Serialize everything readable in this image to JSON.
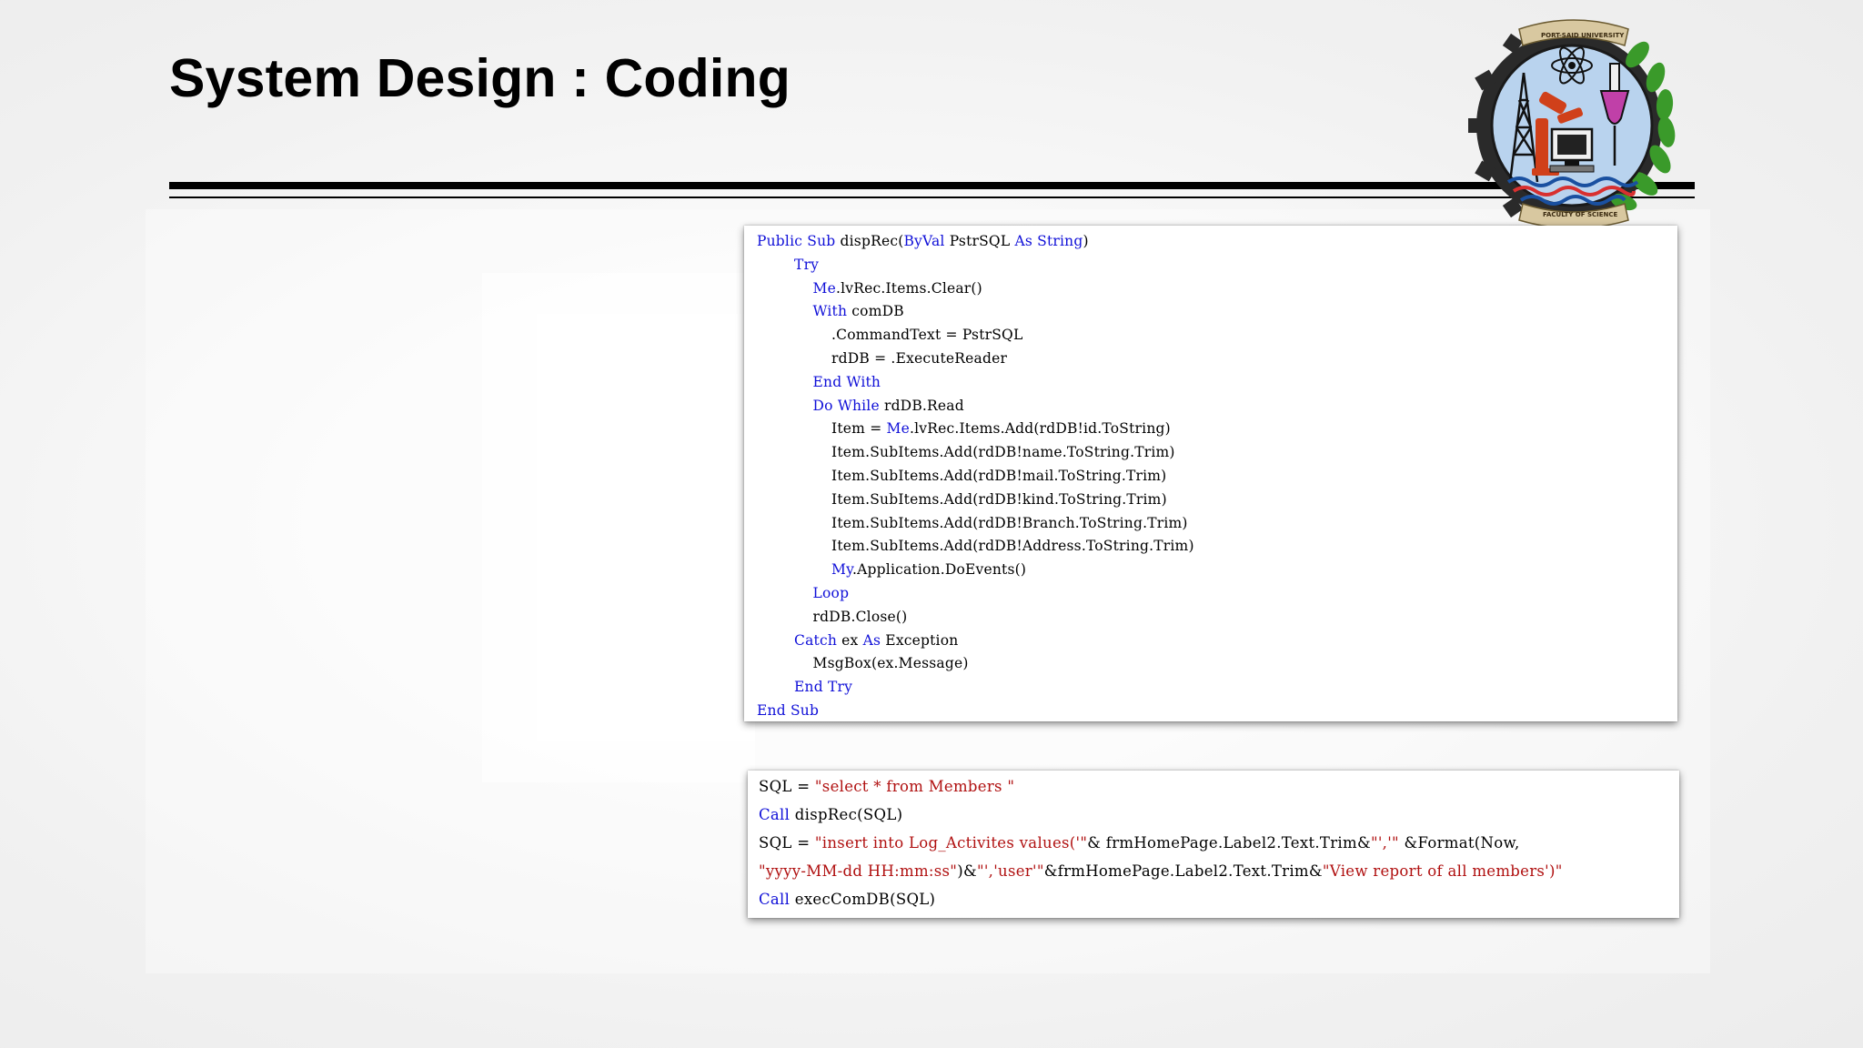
{
  "slide": {
    "title": "System Design : Coding"
  },
  "logo": {
    "top_text": "PORT-SAID UNIVERSITY",
    "bottom_text": "FACULTY OF SCIENCE"
  },
  "colors": {
    "keyword": "#1010d8",
    "string": "#b01010",
    "plain": "#000000",
    "title": "#000000"
  },
  "code_main": {
    "lines": [
      {
        "indent": "",
        "tokens": [
          {
            "t": "keyword",
            "v": "Public Sub"
          },
          {
            "t": "plain",
            "v": " dispRec("
          },
          {
            "t": "keyword",
            "v": "ByVal"
          },
          {
            "t": "plain",
            "v": " PstrSQL "
          },
          {
            "t": "keyword",
            "v": "As String"
          },
          {
            "t": "plain",
            "v": ")"
          }
        ]
      },
      {
        "indent": "        ",
        "tokens": [
          {
            "t": "keyword",
            "v": "Try"
          }
        ]
      },
      {
        "indent": "            ",
        "tokens": [
          {
            "t": "keyword",
            "v": "Me"
          },
          {
            "t": "plain",
            "v": ".lvRec.Items.Clear()"
          }
        ]
      },
      {
        "indent": "            ",
        "tokens": [
          {
            "t": "keyword",
            "v": "With"
          },
          {
            "t": "plain",
            "v": " comDB"
          }
        ]
      },
      {
        "indent": "                ",
        "tokens": [
          {
            "t": "plain",
            "v": ".CommandText = PstrSQL"
          }
        ]
      },
      {
        "indent": "                ",
        "tokens": [
          {
            "t": "plain",
            "v": "rdDB = .ExecuteReader"
          }
        ]
      },
      {
        "indent": "            ",
        "tokens": [
          {
            "t": "keyword",
            "v": "End With"
          }
        ]
      },
      {
        "indent": "            ",
        "tokens": [
          {
            "t": "keyword",
            "v": "Do While"
          },
          {
            "t": "plain",
            "v": " rdDB.Read"
          }
        ]
      },
      {
        "indent": "                ",
        "tokens": [
          {
            "t": "plain",
            "v": "Item = "
          },
          {
            "t": "keyword",
            "v": "Me"
          },
          {
            "t": "plain",
            "v": ".lvRec.Items.Add(rdDB!id.ToString)"
          }
        ]
      },
      {
        "indent": "                ",
        "tokens": [
          {
            "t": "plain",
            "v": "Item.SubItems.Add(rdDB!name.ToString.Trim)"
          }
        ]
      },
      {
        "indent": "                ",
        "tokens": [
          {
            "t": "plain",
            "v": "Item.SubItems.Add(rdDB!mail.ToString.Trim)"
          }
        ]
      },
      {
        "indent": "                ",
        "tokens": [
          {
            "t": "plain",
            "v": "Item.SubItems.Add(rdDB!kind.ToString.Trim)"
          }
        ]
      },
      {
        "indent": "                ",
        "tokens": [
          {
            "t": "plain",
            "v": "Item.SubItems.Add(rdDB!Branch.ToString.Trim)"
          }
        ]
      },
      {
        "indent": "                ",
        "tokens": [
          {
            "t": "plain",
            "v": "Item.SubItems.Add(rdDB!Address.ToString.Trim)"
          }
        ]
      },
      {
        "indent": "                ",
        "tokens": [
          {
            "t": "keyword",
            "v": "My"
          },
          {
            "t": "plain",
            "v": ".Application.DoEvents()"
          }
        ]
      },
      {
        "indent": "            ",
        "tokens": [
          {
            "t": "keyword",
            "v": "Loop"
          }
        ]
      },
      {
        "indent": "            ",
        "tokens": [
          {
            "t": "plain",
            "v": "rdDB.Close()"
          }
        ]
      },
      {
        "indent": "        ",
        "tokens": [
          {
            "t": "keyword",
            "v": "Catch"
          },
          {
            "t": "plain",
            "v": " ex "
          },
          {
            "t": "keyword",
            "v": "As"
          },
          {
            "t": "plain",
            "v": " Exception"
          }
        ]
      },
      {
        "indent": "            ",
        "tokens": [
          {
            "t": "plain",
            "v": "MsgBox(ex.Message)"
          }
        ]
      },
      {
        "indent": "        ",
        "tokens": [
          {
            "t": "keyword",
            "v": "End Try"
          }
        ]
      },
      {
        "indent": "",
        "tokens": [
          {
            "t": "keyword",
            "v": "End Sub"
          }
        ]
      }
    ]
  },
  "code_sql": {
    "lines": [
      {
        "indent": "",
        "tokens": [
          {
            "t": "plain",
            "v": "SQL = "
          },
          {
            "t": "string",
            "v": "\"select * from Members \""
          }
        ]
      },
      {
        "indent": "",
        "tokens": [
          {
            "t": "keyword",
            "v": "Call"
          },
          {
            "t": "plain",
            "v": " dispRec(SQL)"
          }
        ]
      },
      {
        "indent": "",
        "tokens": [
          {
            "t": "plain",
            "v": "SQL = "
          },
          {
            "t": "string",
            "v": "\"insert into Log_Activites values('\""
          },
          {
            "t": "plain",
            "v": "& frmHomePage.Label2.Text.Trim&"
          },
          {
            "t": "string",
            "v": "\"','\""
          },
          {
            "t": "plain",
            "v": " &Format(Now,"
          }
        ]
      },
      {
        "indent": "",
        "tokens": [
          {
            "t": "string",
            "v": "\"yyyy-MM-dd HH:mm:ss\""
          },
          {
            "t": "plain",
            "v": ")&"
          },
          {
            "t": "string",
            "v": "\"','user'\""
          },
          {
            "t": "plain",
            "v": "&frmHomePage.Label2.Text.Trim&"
          },
          {
            "t": "string",
            "v": "\"View report of all members')\""
          }
        ]
      },
      {
        "indent": "",
        "tokens": [
          {
            "t": "keyword",
            "v": "Call"
          },
          {
            "t": "plain",
            "v": " execComDB(SQL)"
          }
        ]
      }
    ]
  }
}
